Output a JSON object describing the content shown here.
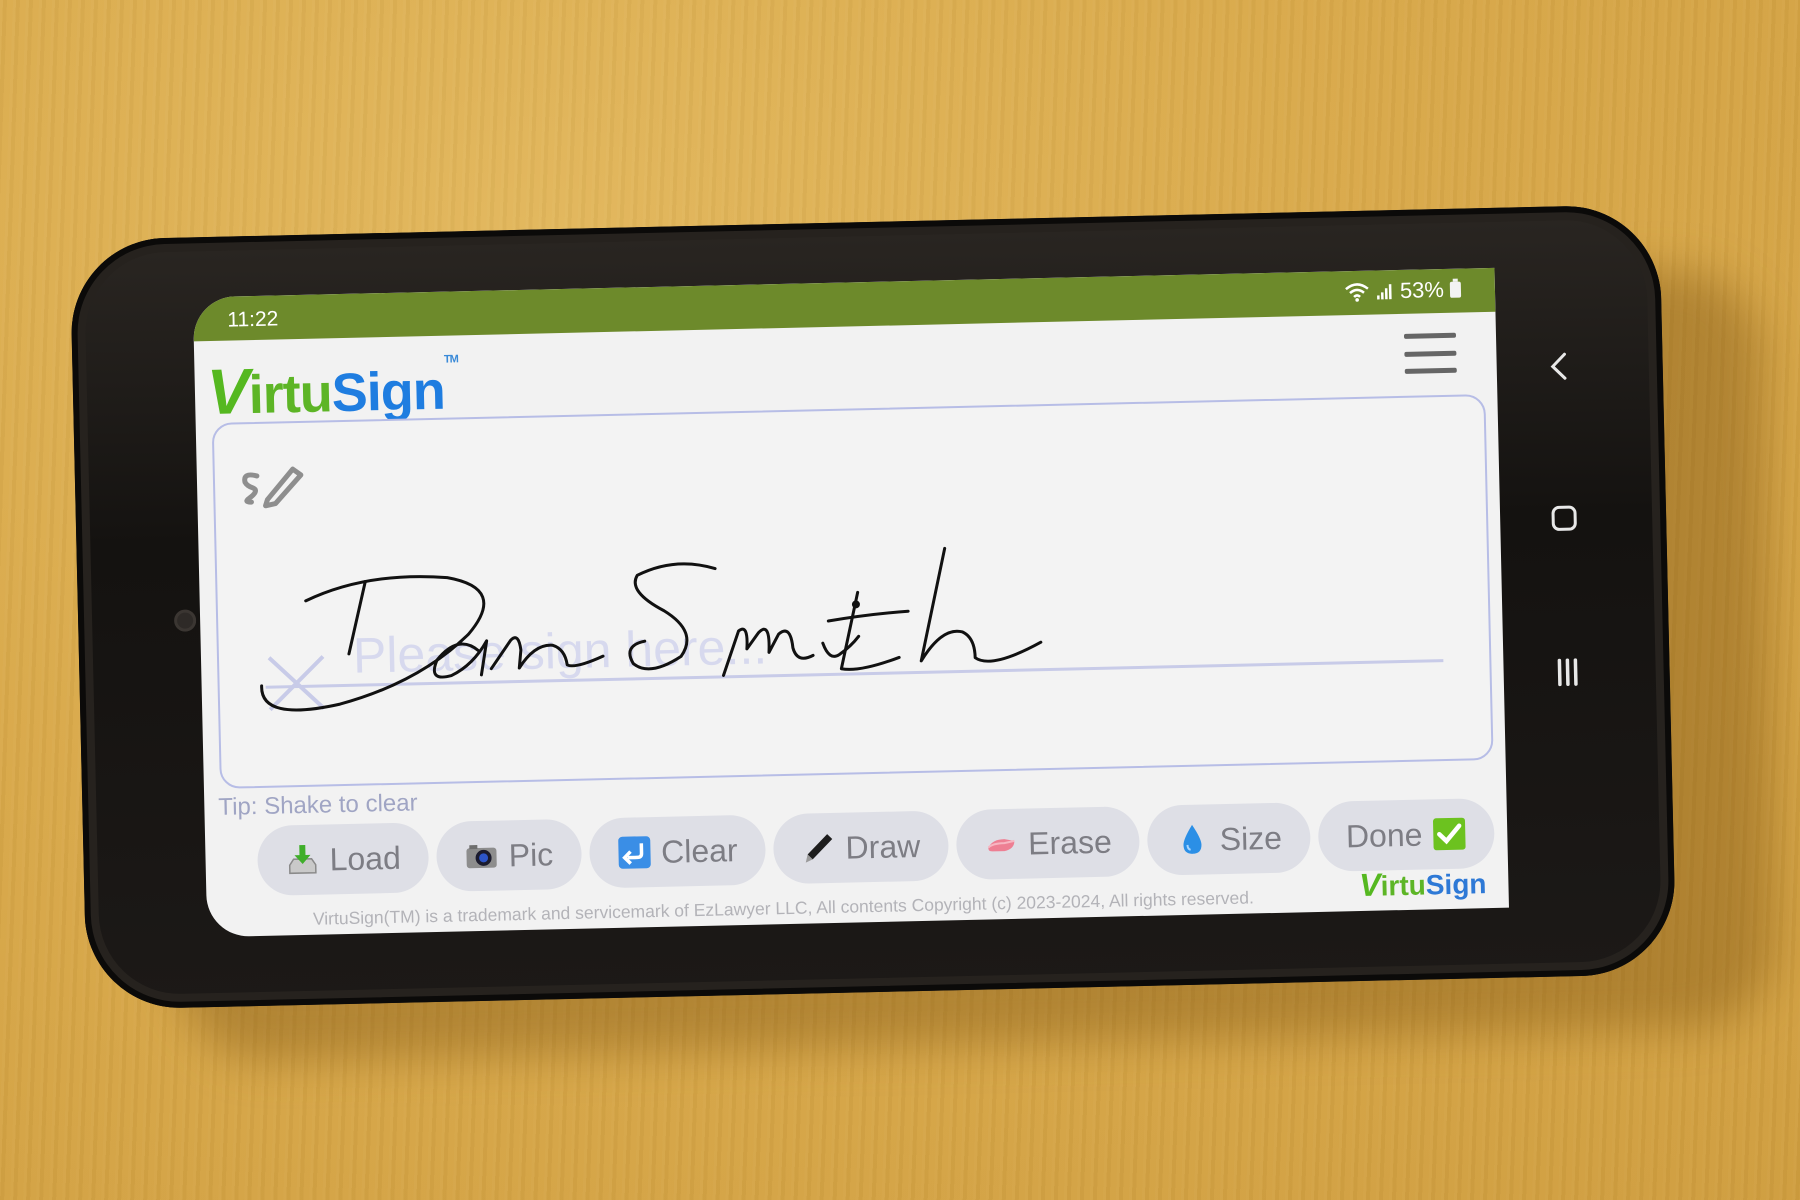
{
  "status_bar": {
    "time": "11:22",
    "battery": "53%",
    "icons": [
      "wifi-icon",
      "signal-icon",
      "battery-icon"
    ],
    "color": "#6d8a2b"
  },
  "header": {
    "logo": {
      "v": "V",
      "irtu": "irtu",
      "sign": "Sign",
      "tm": "TM"
    },
    "menu_icon": "hamburger-menu-icon"
  },
  "signature_pad": {
    "placeholder": "Please sign here...",
    "signed_name": "Dan Smith",
    "pen_icon": "signature-pen-icon",
    "x_marker": "sign-here-x-icon",
    "border_color": "#b7bde6"
  },
  "tip": "Tip: Shake to clear",
  "toolbar": {
    "buttons": [
      {
        "label": "Load",
        "icon": "download-tray-icon"
      },
      {
        "label": "Pic",
        "icon": "camera-icon"
      },
      {
        "label": "Clear",
        "icon": "undo-arrow-icon"
      },
      {
        "label": "Draw",
        "icon": "pen-icon"
      },
      {
        "label": "Erase",
        "icon": "eraser-icon"
      },
      {
        "label": "Size",
        "icon": "droplet-icon"
      },
      {
        "label": "Done",
        "icon": "checkmark-icon"
      }
    ]
  },
  "footer": {
    "copyright": "VirtuSign(TM) is a trademark and servicemark of EzLawyer LLC, All contents Copyright (c) 2023-2024, All rights reserved.",
    "logo": {
      "v": "V",
      "irtu": "irtu",
      "sign": "Sign"
    }
  },
  "system_nav": {
    "back": "back-icon",
    "home": "home-icon",
    "recents": "recents-icon"
  },
  "colors": {
    "logo_green": "#5db526",
    "logo_blue": "#1f7de0",
    "button_bg": "#dedfe6",
    "tip_text": "#a0a5c4"
  }
}
